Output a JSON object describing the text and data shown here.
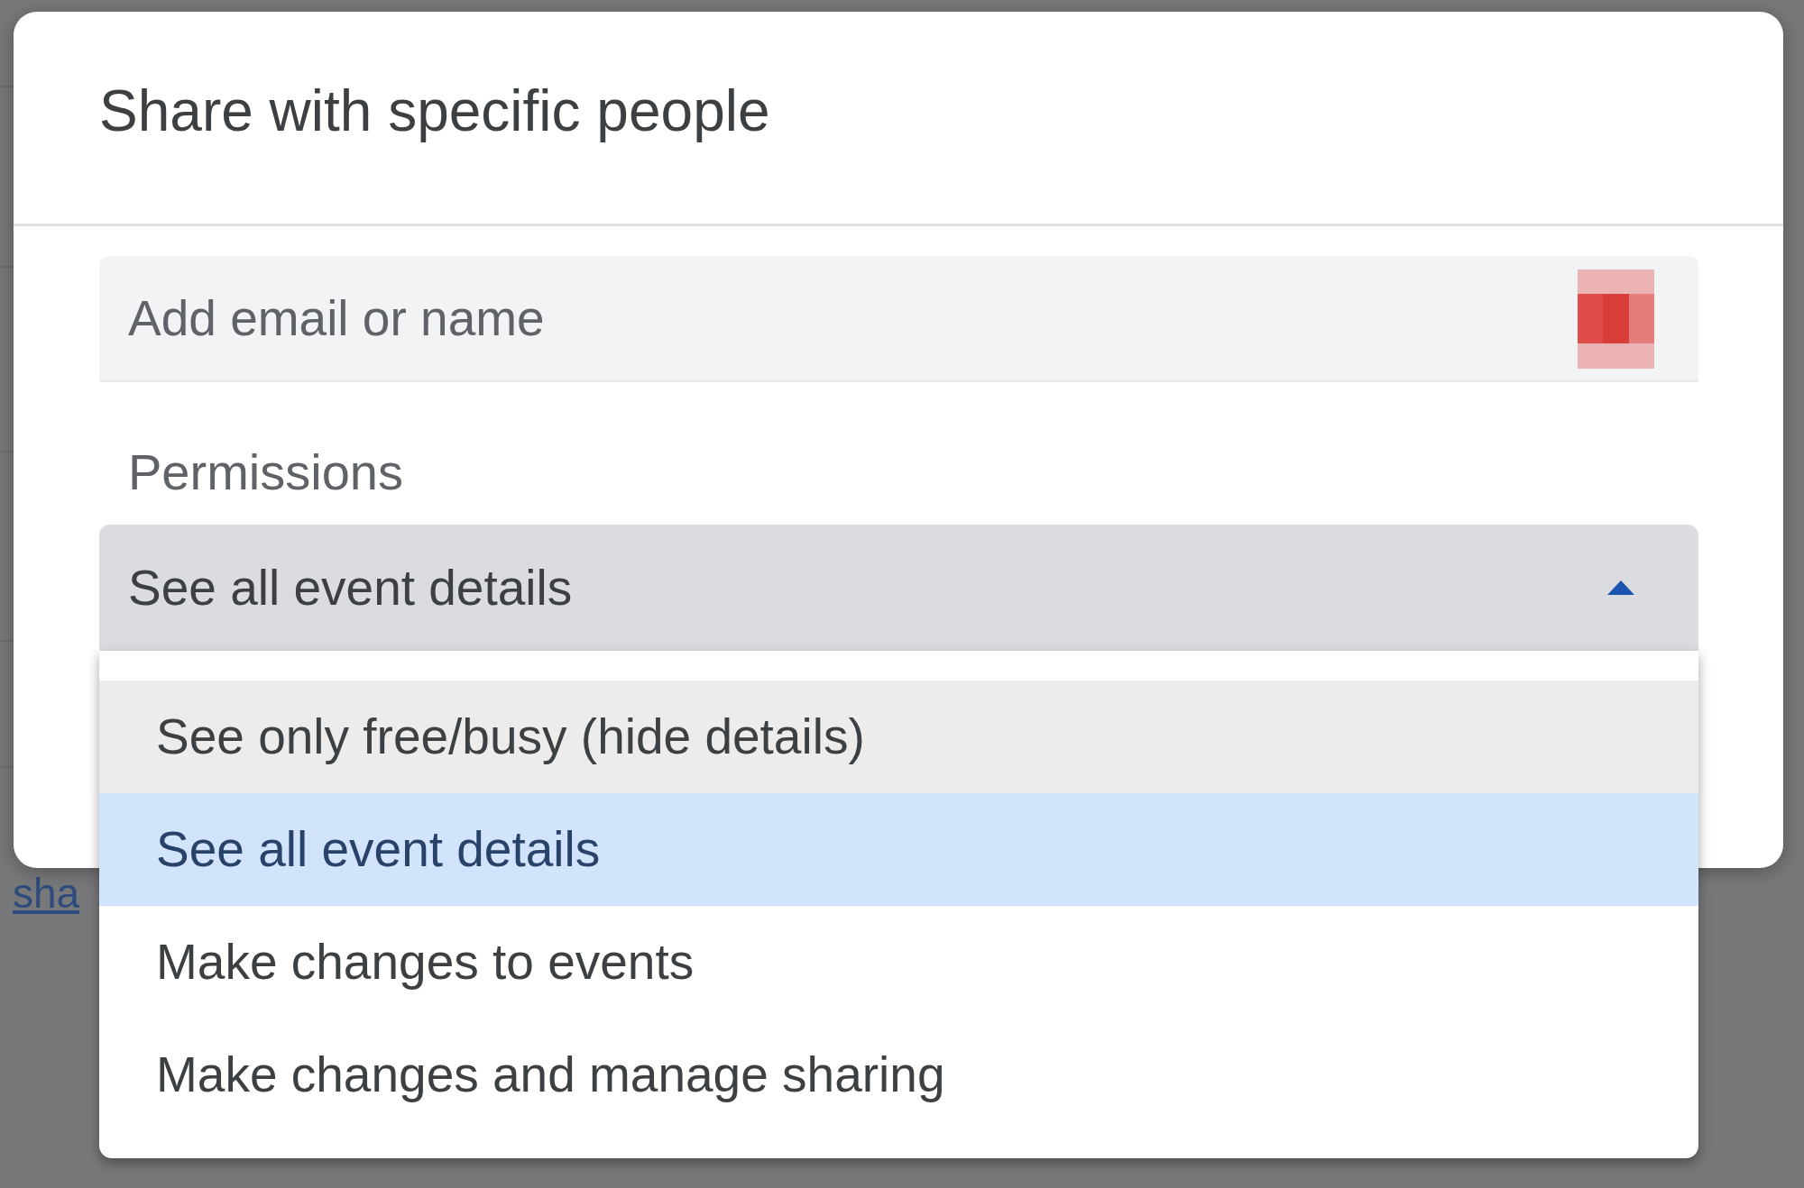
{
  "background": {
    "link": "sha"
  },
  "dialog": {
    "title": "Share with specific people",
    "input": {
      "placeholder": "Add email or name"
    },
    "permissions_label": "Permissions",
    "select": {
      "value": "See all event details",
      "expanded": true
    },
    "options": [
      {
        "label": "See only free/busy (hide details)",
        "selected": false,
        "hovered": true
      },
      {
        "label": "See all event details",
        "selected": true,
        "hovered": false
      },
      {
        "label": "Make changes to events",
        "selected": false,
        "hovered": false
      },
      {
        "label": "Make changes and manage sharing",
        "selected": false,
        "hovered": false
      }
    ]
  }
}
